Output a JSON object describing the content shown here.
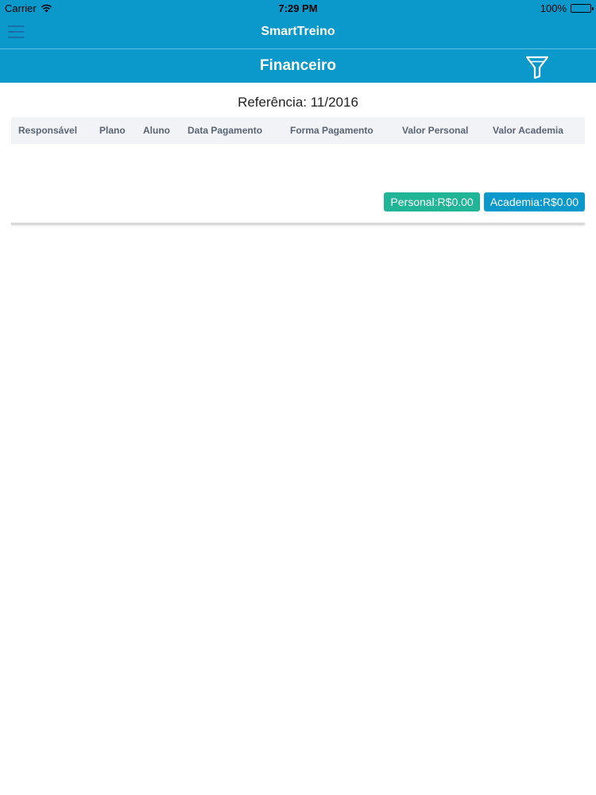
{
  "status_bar": {
    "carrier": "Carrier",
    "time": "7:29 PM",
    "battery": "100%"
  },
  "nav": {
    "app_title": "SmartTreino",
    "menu_icon": "hamburger-menu-icon"
  },
  "header": {
    "title": "Financeiro",
    "filter_icon": "filter-funnel-icon"
  },
  "reference": {
    "label": "Referência: 11/2016"
  },
  "table": {
    "columns": [
      "Responsável",
      "Plano",
      "Aluno",
      "Data Pagamento",
      "Forma Pagamento",
      "Valor Personal",
      "Valor Academia"
    ],
    "rows": []
  },
  "totals": {
    "personal": "Personal:R$0.00",
    "academia": "Academia:R$0.00"
  },
  "colors": {
    "header_blue": "#0b99cc",
    "personal_green": "#1fb596",
    "academia_blue": "#0b99cc"
  }
}
